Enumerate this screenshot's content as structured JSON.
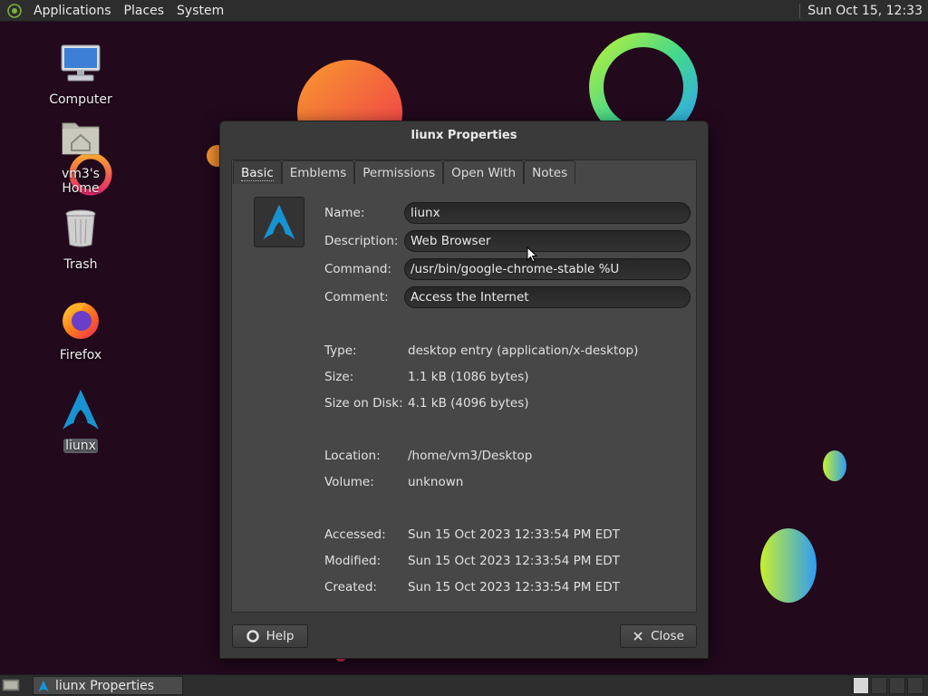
{
  "top_panel": {
    "menus": [
      "Applications",
      "Places",
      "System"
    ],
    "clock": "Sun Oct 15, 12:33"
  },
  "desktop_icons": [
    {
      "label": "Computer",
      "icon": "computer-icon"
    },
    {
      "label": "vm3's Home",
      "icon": "home-folder-icon"
    },
    {
      "label": "Trash",
      "icon": "trash-icon"
    },
    {
      "label": "Firefox",
      "icon": "firefox-icon"
    },
    {
      "label": "liunx",
      "icon": "arch-launcher-icon",
      "selected": true
    }
  ],
  "dialog": {
    "title": "liunx Properties",
    "tabs": [
      "Basic",
      "Emblems",
      "Permissions",
      "Open With",
      "Notes"
    ],
    "active_tab": "Basic",
    "fields": {
      "name": {
        "label": "Name:",
        "value": "liunx"
      },
      "description": {
        "label": "Description:",
        "value": "Web Browser"
      },
      "command": {
        "label": "Command:",
        "value": "/usr/bin/google-chrome-stable %U"
      },
      "comment": {
        "label": "Comment:",
        "value": "Access the Internet"
      }
    },
    "info": {
      "type": {
        "label": "Type:",
        "value": "desktop entry (application/x-desktop)"
      },
      "size": {
        "label": "Size:",
        "value": "1.1 kB (1086 bytes)"
      },
      "size_on_disk": {
        "label": "Size on Disk:",
        "value": "4.1 kB (4096 bytes)"
      },
      "location": {
        "label": "Location:",
        "value": "/home/vm3/Desktop"
      },
      "volume": {
        "label": "Volume:",
        "value": "unknown"
      },
      "accessed": {
        "label": "Accessed:",
        "value": "Sun 15 Oct 2023 12:33:54 PM EDT"
      },
      "modified": {
        "label": "Modified:",
        "value": "Sun 15 Oct 2023 12:33:54 PM EDT"
      },
      "created": {
        "label": "Created:",
        "value": "Sun 15 Oct 2023 12:33:54 PM EDT"
      }
    },
    "buttons": {
      "help": "Help",
      "close": "Close"
    }
  },
  "taskbar": {
    "window_label": "liunx Properties"
  },
  "colors": {
    "desktop_bg": "#22091c",
    "panel_bg": "#2d2d2d",
    "dialog_bg": "#3a3a3a",
    "arch_blue": "#1793d1"
  }
}
